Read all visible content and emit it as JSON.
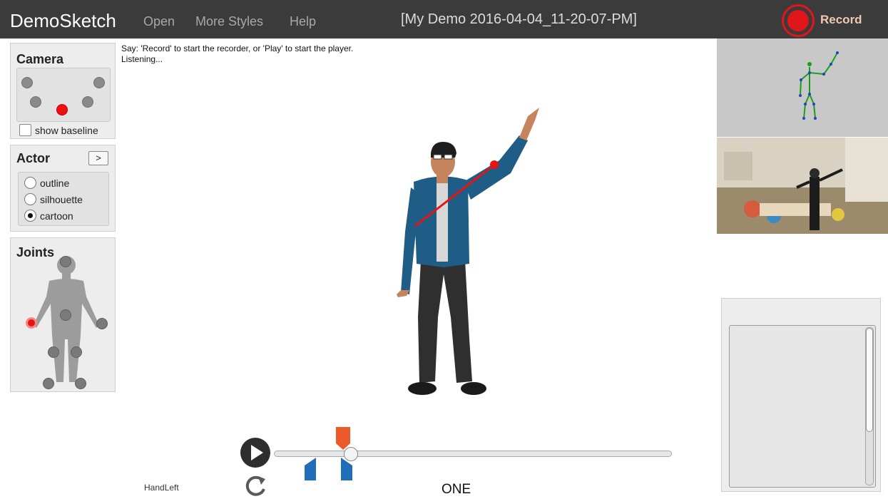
{
  "app": {
    "brand": "DemoSketch",
    "menu": [
      "Open",
      "More Styles",
      "Help"
    ],
    "title": "[My Demo 2016-04-04_11-20-07-PM]",
    "record_label": "Record",
    "accent_color": "#e0161a"
  },
  "camera_panel": {
    "title": "Camera",
    "checkbox_label": "show baseline",
    "checkbox_checked": false,
    "active_camera_index": 4
  },
  "actor_panel": {
    "title": "Actor",
    "expand_label": ">",
    "options": [
      "outline",
      "silhouette",
      "cartoon"
    ],
    "selected": "cartoon"
  },
  "joints_panel": {
    "title": "Joints",
    "selected_joint": "HandLeft"
  },
  "messages": {
    "line1": "Say: 'Record' to start the recorder, or 'Play' to start the player.",
    "line2": "Listening..."
  },
  "timeline": {
    "joint_name": "HandLeft",
    "word": "ONE",
    "progress": 0.19
  }
}
